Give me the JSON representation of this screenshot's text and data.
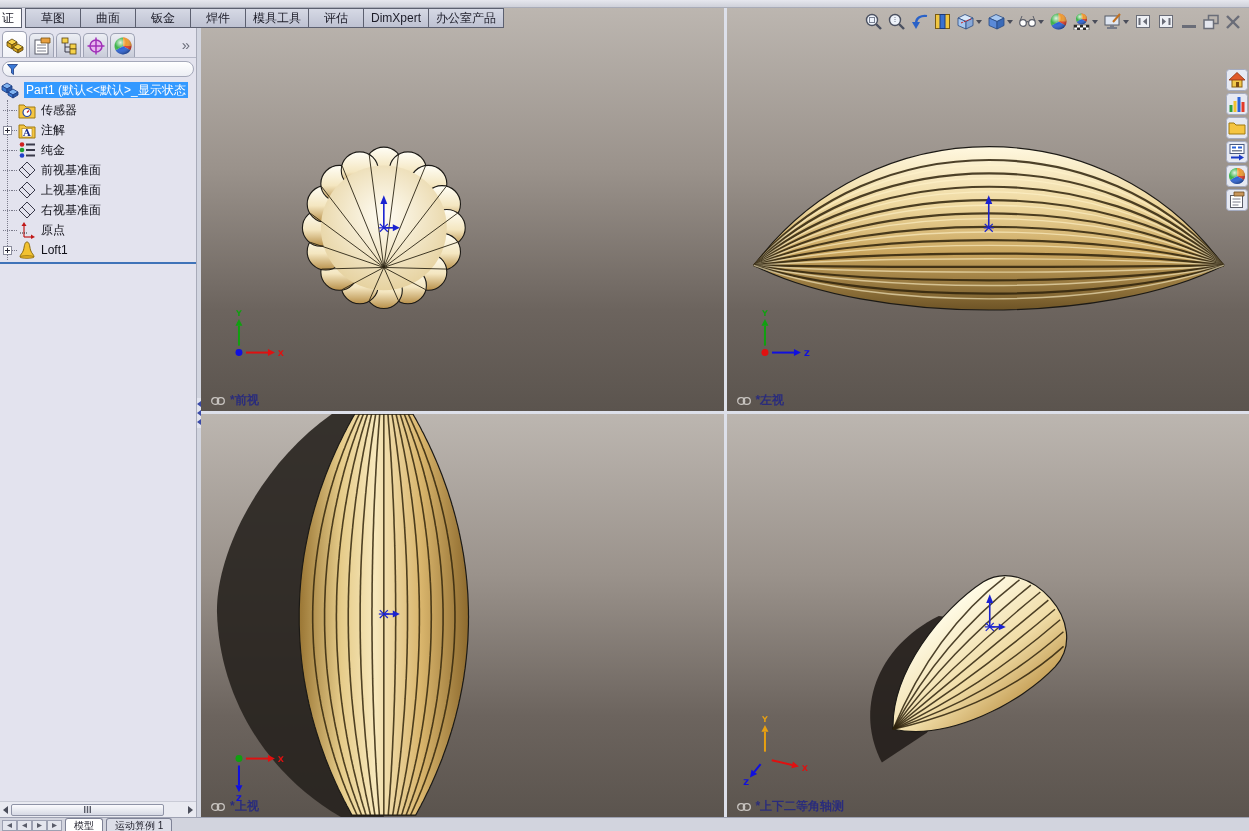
{
  "command_tabs": [
    {
      "label": "证",
      "selected": true
    },
    {
      "label": "草图",
      "selected": false
    },
    {
      "label": "曲面",
      "selected": false
    },
    {
      "label": "钣金",
      "selected": false
    },
    {
      "label": "焊件",
      "selected": false
    },
    {
      "label": "模具工具",
      "selected": false
    },
    {
      "label": "评估",
      "selected": false
    },
    {
      "label": "DimXpert",
      "selected": false
    },
    {
      "label": "办公室产品",
      "selected": false
    }
  ],
  "feature_manager": {
    "tabs": [
      {
        "kind": "features",
        "selected": true
      },
      {
        "kind": "properties",
        "selected": false
      },
      {
        "kind": "configurations",
        "selected": false
      },
      {
        "kind": "dimxpert",
        "selected": false
      },
      {
        "kind": "display",
        "selected": false
      }
    ],
    "more": "»",
    "tree": {
      "label": "Part1 (默认<<默认>_显示状态",
      "kind": "part",
      "selected": true,
      "children": [
        {
          "label": "传感器",
          "kind": "sensors",
          "collapsed": false,
          "selected": false
        },
        {
          "label": "注解",
          "kind": "annotations",
          "icon_letter": "A",
          "collapsed": true,
          "selected": false
        },
        {
          "label": "纯金",
          "kind": "material",
          "collapsed": false,
          "selected": false
        },
        {
          "label": "前视基准面",
          "kind": "plane",
          "collapsed": false,
          "selected": false
        },
        {
          "label": "上视基准面",
          "kind": "plane",
          "collapsed": false,
          "selected": false
        },
        {
          "label": "右视基准面",
          "kind": "plane",
          "collapsed": false,
          "selected": false
        },
        {
          "label": "原点",
          "kind": "origin",
          "collapsed": false,
          "selected": false
        },
        {
          "label": "Loft1",
          "kind": "feature",
          "collapsed": true,
          "selected": false
        }
      ]
    }
  },
  "viewports": [
    {
      "kind": "front",
      "label": "*前视",
      "axes": [
        {
          "kind": "up",
          "label": "Y",
          "color": "#10a010"
        },
        {
          "kind": "right",
          "label": "X",
          "color": "#e01010"
        },
        {
          "kind": "dot",
          "color": "#1010e0"
        }
      ]
    },
    {
      "kind": "left",
      "label": "*左视",
      "axes": [
        {
          "kind": "up",
          "label": "Y",
          "color": "#10a010"
        },
        {
          "kind": "right",
          "label": "Z",
          "color": "#1010e0"
        },
        {
          "kind": "dot",
          "color": "#e01010"
        }
      ]
    },
    {
      "kind": "top",
      "label": "*上视",
      "axes": [
        {
          "kind": "right",
          "label": "X",
          "color": "#e01010"
        },
        {
          "kind": "down",
          "label": "Z",
          "color": "#1010e0"
        },
        {
          "kind": "dot",
          "color": "#10a010"
        }
      ]
    },
    {
      "kind": "iso",
      "label": "*上下二等角轴测",
      "axes": [
        {
          "kind": "up",
          "label": "Y",
          "color": "#e8a010"
        },
        {
          "kind": "down-right",
          "label": "X",
          "color": "#e01010"
        },
        {
          "kind": "down-left",
          "label": "Z",
          "color": "#1010e0"
        }
      ]
    }
  ],
  "bottom_tabs": [
    {
      "label": "模型",
      "selected": true
    },
    {
      "label": "运动算例 1",
      "selected": false
    }
  ]
}
